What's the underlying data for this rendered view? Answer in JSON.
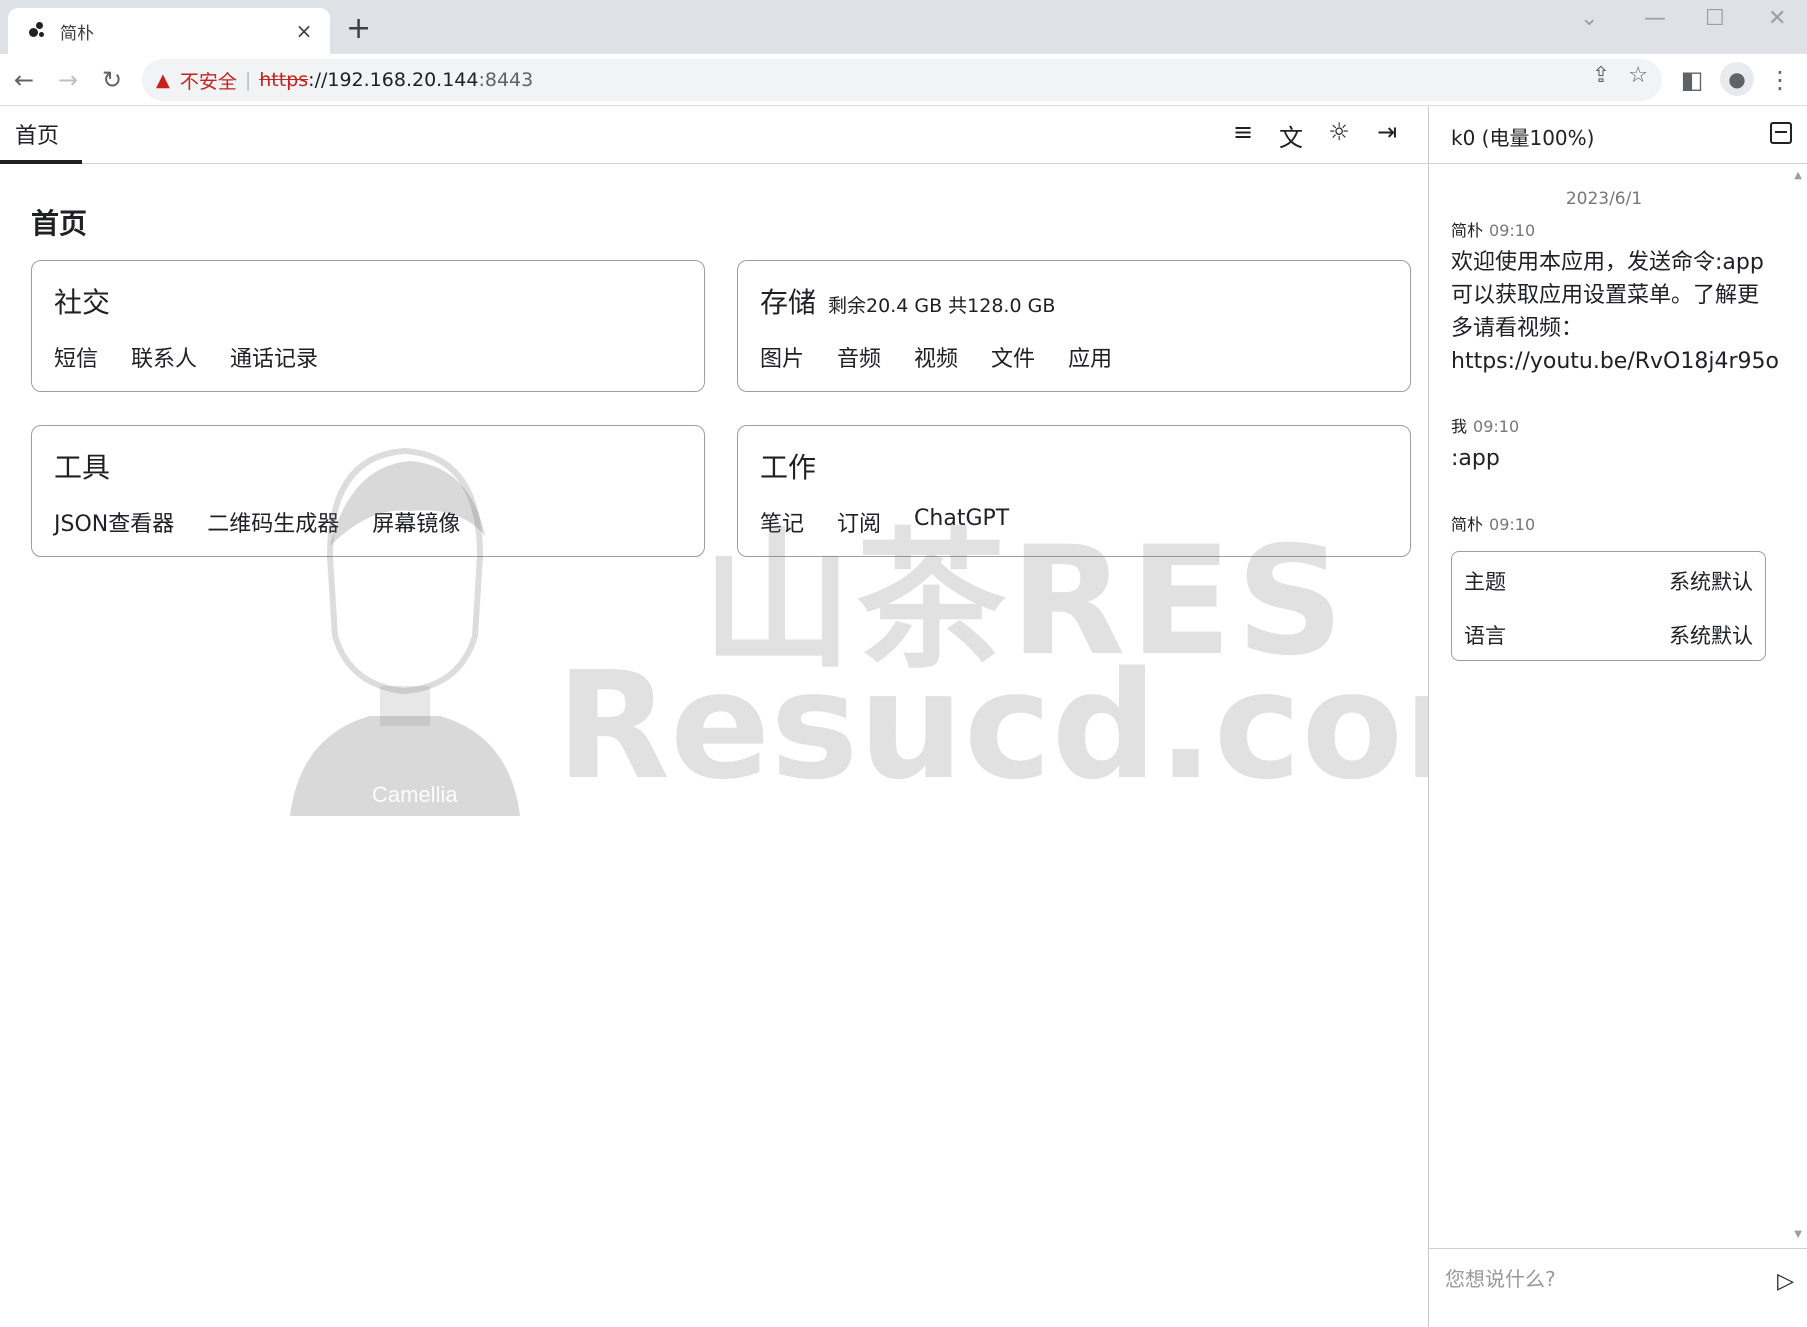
{
  "browser": {
    "tab_title": "简朴",
    "tab_close": "×",
    "new_tab": "+",
    "security_label": "不安全",
    "url_protocol": "https",
    "url_host": "://192.168.20.144",
    "url_port": ":8443"
  },
  "app": {
    "nav_tab": "首页",
    "page_title": "首页",
    "header_icons": [
      "sort-icon",
      "translate-icon",
      "theme-icon",
      "logout-icon"
    ],
    "cards": [
      {
        "title": "社交",
        "subtitle": "",
        "links": [
          "短信",
          "联系人",
          "通话记录"
        ]
      },
      {
        "title": "存储",
        "subtitle": "剩余20.4 GB 共128.0 GB",
        "links": [
          "图片",
          "音频",
          "视频",
          "文件",
          "应用"
        ]
      },
      {
        "title": "工具",
        "subtitle": "",
        "links": [
          "JSON查看器",
          "二维码生成器",
          "屏幕镜像"
        ]
      },
      {
        "title": "工作",
        "subtitle": "",
        "links": [
          "笔记",
          "订阅",
          "ChatGPT"
        ]
      }
    ]
  },
  "watermark": {
    "line1": "山茶RES",
    "line2": "Resucd.com",
    "mascot_label": "Camellia"
  },
  "chat": {
    "title": "k0 (电量100%)",
    "date": "2023/6/1",
    "messages": [
      {
        "sender": "简朴",
        "time": "09:10",
        "text": "欢迎使用本应用，发送命令:app可以获取应用设置菜单。了解更多请看视频：https://youtu.be/RvO18j4r95o"
      },
      {
        "sender": "我",
        "time": "09:10",
        "text": ":app"
      },
      {
        "sender": "简朴",
        "time": "09:10",
        "text": ""
      }
    ],
    "settings": [
      {
        "label": "主题",
        "value": "系统默认"
      },
      {
        "label": "语言",
        "value": "系统默认"
      }
    ],
    "input_placeholder": "您想说什么?"
  }
}
